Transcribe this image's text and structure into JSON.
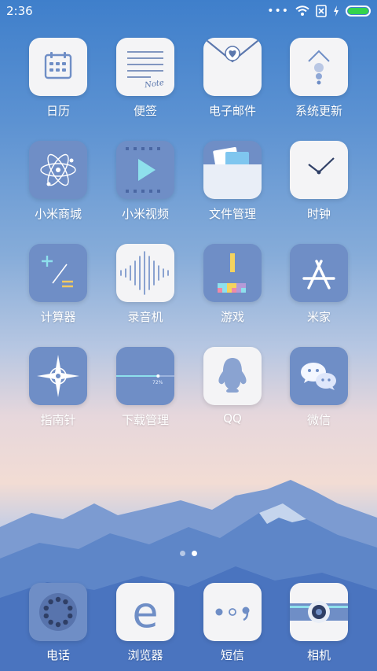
{
  "status_bar": {
    "time": "2:36",
    "more_dots": "•••"
  },
  "apps": [
    {
      "label": "日历"
    },
    {
      "label": "便签",
      "note_icon_text": "Note"
    },
    {
      "label": "电子邮件"
    },
    {
      "label": "系统更新"
    },
    {
      "label": "小米商城"
    },
    {
      "label": "小米视频"
    },
    {
      "label": "文件管理"
    },
    {
      "label": "时钟"
    },
    {
      "label": "计算器"
    },
    {
      "label": "录音机"
    },
    {
      "label": "游戏"
    },
    {
      "label": "米家"
    },
    {
      "label": "指南针"
    },
    {
      "label": "下载管理",
      "progress_text": "72%",
      "progress": 0.72
    },
    {
      "label": "QQ"
    },
    {
      "label": "微信"
    }
  ],
  "page_indicator": {
    "pages": 2,
    "active": 2
  },
  "dock": [
    {
      "label": "电话"
    },
    {
      "label": "浏览器",
      "glyph": "e"
    },
    {
      "label": "短信"
    },
    {
      "label": "相机"
    }
  ],
  "colors": {
    "icon_blue": "#6f8ec6",
    "icon_light": "#f4f4f6",
    "battery_green": "#34d34c",
    "sky_top": "#3f7fcb"
  }
}
